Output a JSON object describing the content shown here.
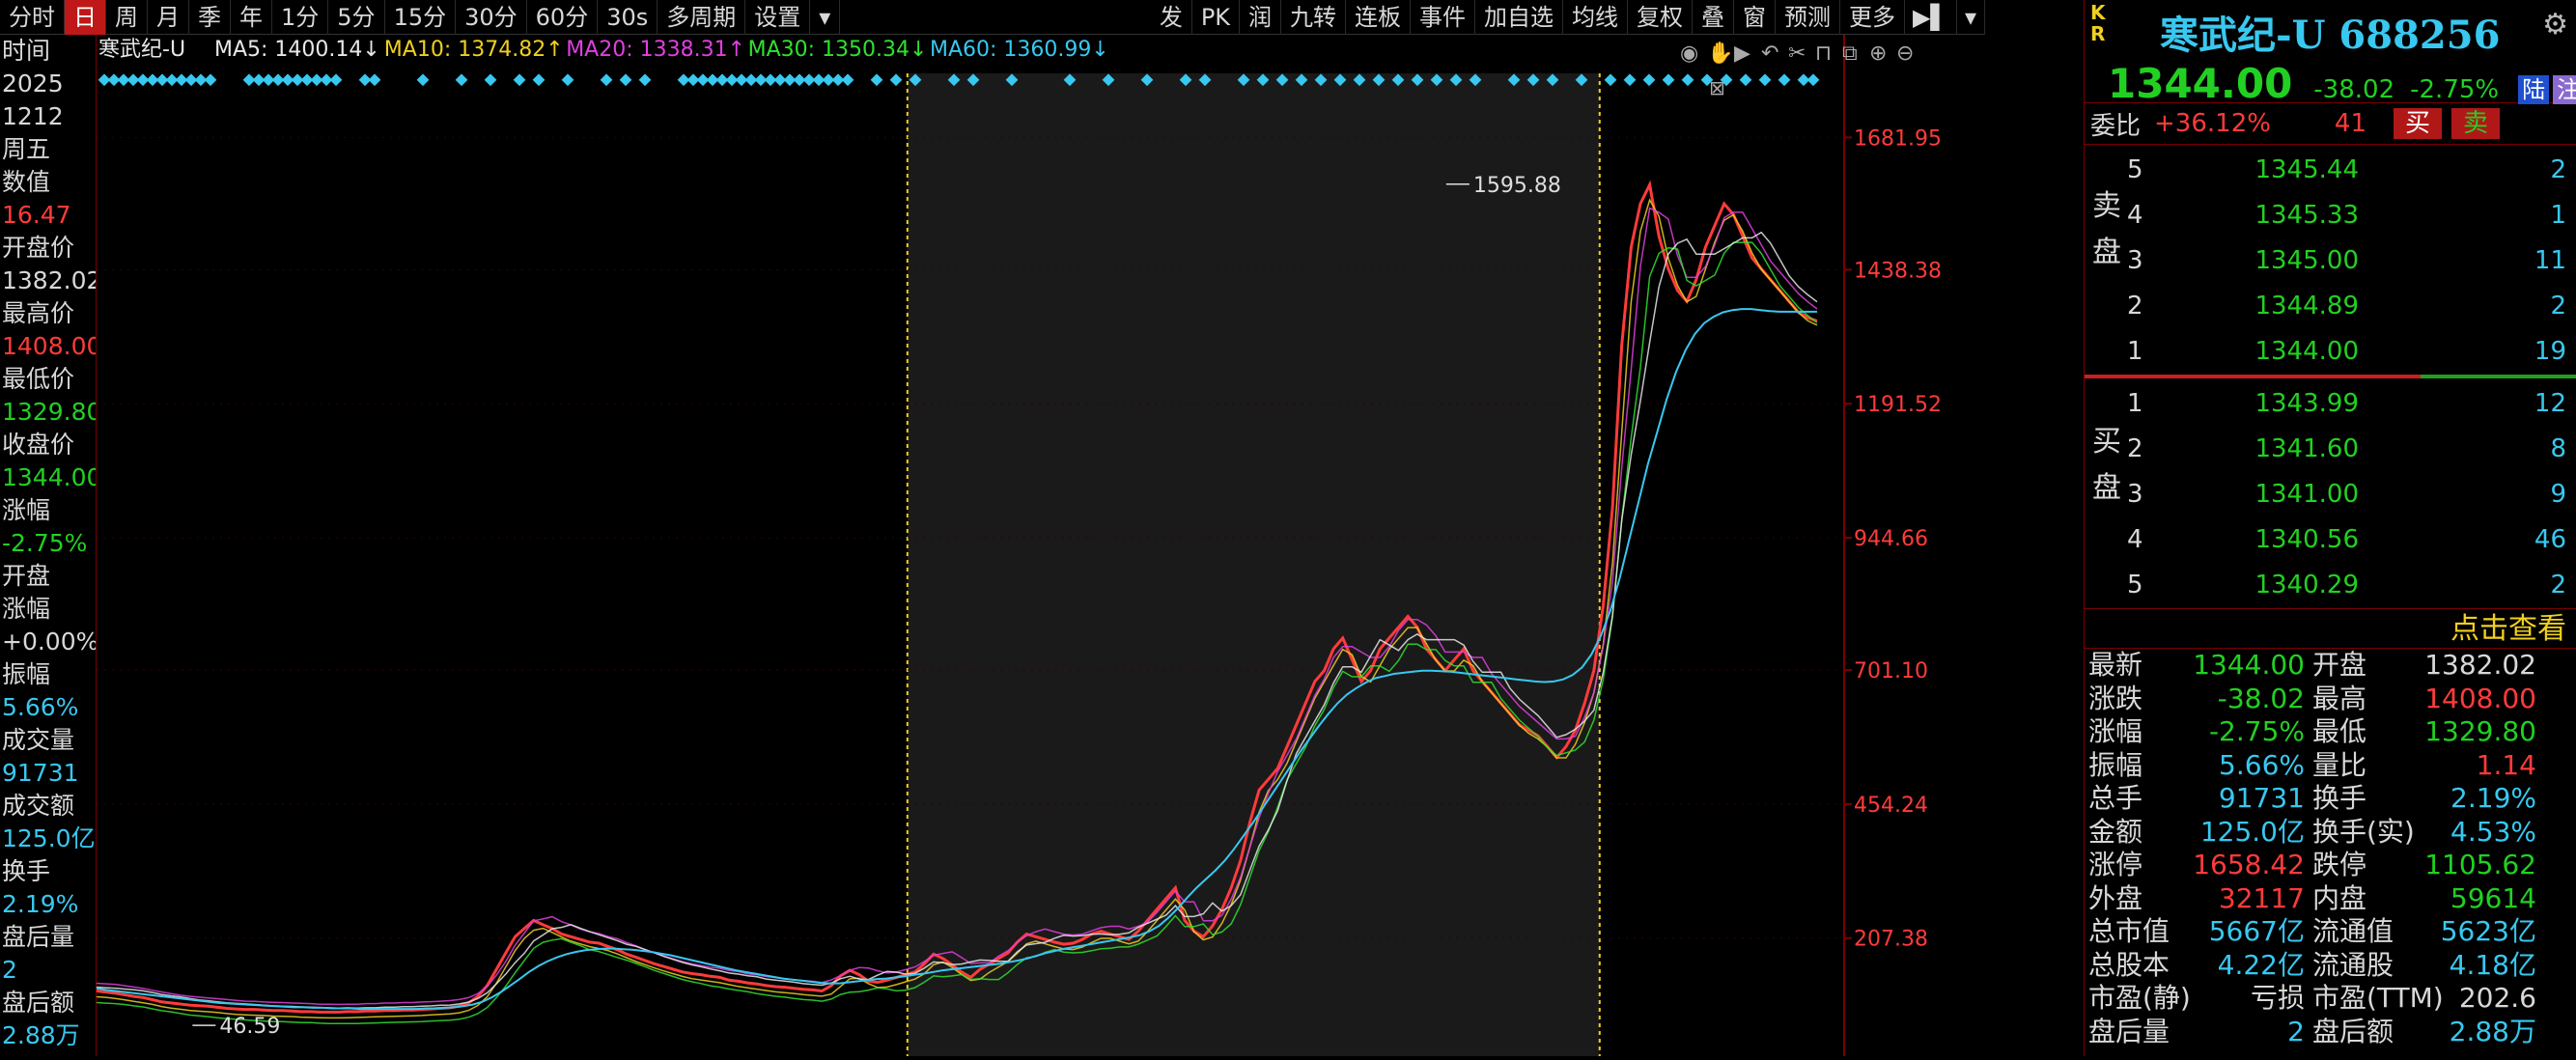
{
  "toolbar": {
    "left_items": [
      "分时",
      "日",
      "周",
      "月",
      "季",
      "年",
      "1分",
      "5分",
      "15分",
      "30分",
      "60分",
      "30s",
      "多周期",
      "设置"
    ],
    "active_item": "日",
    "dropdown_item": "30s",
    "right_items": [
      "发",
      "PK",
      "润",
      "九转",
      "连板",
      "事件",
      "加自选",
      "均线",
      "复权",
      "叠",
      "窗",
      "预测",
      "更多"
    ]
  },
  "left_panel": {
    "rows": [
      {
        "text": "时间",
        "color": "w"
      },
      {
        "text": "2025",
        "color": "w"
      },
      {
        "text": "1212",
        "color": "w"
      },
      {
        "text": "周五",
        "color": "w"
      },
      {
        "text": "数值",
        "color": "w"
      },
      {
        "text": "16.47",
        "color": "r"
      },
      {
        "text": "开盘价",
        "color": "w"
      },
      {
        "text": "1382.02",
        "color": "w"
      },
      {
        "text": "最高价",
        "color": "w"
      },
      {
        "text": "1408.00",
        "color": "r"
      },
      {
        "text": "最低价",
        "color": "w"
      },
      {
        "text": "1329.80",
        "color": "g"
      },
      {
        "text": "收盘价",
        "color": "w"
      },
      {
        "text": "1344.00",
        "color": "g"
      },
      {
        "text": "涨幅",
        "color": "w"
      },
      {
        "text": "-2.75%",
        "color": "g"
      },
      {
        "text": "开盘",
        "color": "w"
      },
      {
        "text": "涨幅",
        "color": "w"
      },
      {
        "text": "+0.00%",
        "color": "w"
      },
      {
        "text": "振幅",
        "color": "w"
      },
      {
        "text": "5.66%",
        "color": "c"
      },
      {
        "text": "成交量",
        "color": "w"
      },
      {
        "text": "91731",
        "color": "c"
      },
      {
        "text": "成交额",
        "color": "w"
      },
      {
        "text": "125.0亿",
        "color": "c"
      },
      {
        "text": "换手",
        "color": "w"
      },
      {
        "text": "2.19%",
        "color": "c"
      },
      {
        "text": "盘后量",
        "color": "w"
      },
      {
        "text": "2",
        "color": "c"
      },
      {
        "text": "盘后额",
        "color": "w"
      },
      {
        "text": "2.88万",
        "color": "c"
      }
    ]
  },
  "chart_header": {
    "stock": "寒武纪-U",
    "ma": [
      {
        "label": "MA5: 1400.14↓",
        "color": "#e8e8e8"
      },
      {
        "label": "MA10: 1374.82↑",
        "color": "#f0d020"
      },
      {
        "label": "MA20: 1338.31↑",
        "color": "#e040e0"
      },
      {
        "label": "MA30: 1350.34↓",
        "color": "#30e030"
      },
      {
        "label": "MA60: 1360.99↓",
        "color": "#38c8f0"
      }
    ]
  },
  "chart_data": {
    "type": "line",
    "y_ticks": [
      1681.95,
      1438.38,
      1191.52,
      944.66,
      701.1,
      454.24,
      207.38
    ],
    "ylim": [
      -10,
      1800
    ],
    "annotations": [
      {
        "label": "1595.88",
        "x": 0.774,
        "value": 1595.88
      },
      {
        "label": "46.59",
        "x": 0.055,
        "value": 46.59
      }
    ],
    "highlight_range": [
      0.465,
      0.862
    ],
    "series": [
      {
        "name": "K",
        "color": "#ff3b3b",
        "values": [
          110,
          108,
          106,
          103,
          100,
          98,
          94,
          90,
          88,
          86,
          84,
          83,
          82,
          80,
          78,
          77,
          76,
          76,
          75,
          74,
          74,
          73,
          72,
          72,
          71,
          71,
          71,
          72,
          72,
          73,
          73,
          74,
          74,
          75,
          75,
          76,
          77,
          78,
          79,
          82,
          88,
          100,
          120,
          150,
          180,
          210,
          225,
          240,
          232,
          225,
          215,
          210,
          205,
          200,
          198,
          192,
          186,
          178,
          172,
          166,
          160,
          155,
          150,
          145,
          142,
          140,
          137,
          135,
          130,
          128,
          125,
          123,
          120,
          118,
          117,
          115,
          113,
          112,
          110,
          120,
          138,
          148,
          140,
          128,
          126,
          130,
          135,
          140,
          145,
          160,
          178,
          170,
          158,
          145,
          135,
          150,
          160,
          170,
          180,
          200,
          215,
          210,
          205,
          200,
          196,
          198,
          205,
          215,
          220,
          215,
          210,
          205,
          220,
          240,
          260,
          280,
          300,
          240,
          220,
          210,
          230,
          260,
          300,
          350,
          420,
          480,
          500,
          520,
          560,
          600,
          640,
          680,
          700,
          740,
          760,
          720,
          680,
          700,
          740,
          760,
          780,
          800,
          780,
          740,
          720,
          700,
          720,
          740,
          700,
          680,
          660,
          640,
          620,
          600,
          590,
          580,
          560,
          540,
          560,
          590,
          640,
          700,
          820,
          1000,
          1300,
          1480,
          1560,
          1595,
          1500,
          1440,
          1400,
          1380,
          1420,
          1480,
          1520,
          1560,
          1540,
          1500,
          1460,
          1440,
          1420,
          1400,
          1380,
          1360,
          1350,
          1344
        ]
      },
      {
        "name": "MA60",
        "color": "#38c8f0",
        "values": [
          115,
          112,
          110,
          108,
          106,
          104,
          102,
          100,
          98,
          96,
          94,
          92,
          90,
          88,
          87,
          86,
          85,
          84,
          83,
          82,
          81,
          80,
          80,
          79,
          79,
          78,
          78,
          78,
          77,
          77,
          77,
          77,
          77,
          77,
          77,
          78,
          78,
          79,
          80,
          82,
          85,
          90,
          98,
          108,
          120,
          132,
          145,
          156,
          165,
          172,
          178,
          182,
          185,
          187,
          188,
          188,
          187,
          186,
          184,
          182,
          179,
          176,
          172,
          168,
          164,
          160,
          156,
          152,
          148,
          145,
          142,
          139,
          136,
          133,
          131,
          129,
          127,
          125,
          124,
          124,
          126,
          128,
          130,
          132,
          133,
          135,
          137,
          140,
          142,
          145,
          148,
          150,
          152,
          154,
          156,
          158,
          160,
          163,
          166,
          170,
          175,
          180,
          184,
          188,
          191,
          194,
          197,
          200,
          203,
          206,
          209,
          213,
          220,
          230,
          245,
          262,
          282,
          300,
          316,
          332,
          350,
          372,
          396,
          420,
          446,
          472,
          498,
          524,
          550,
          574,
          598,
          620,
          640,
          656,
          668,
          678,
          686,
          690,
          694,
          696,
          698,
          700,
          700,
          699,
          698,
          696,
          694,
          692,
          690,
          688,
          686,
          684,
          682,
          680,
          679,
          680,
          684,
          692,
          706,
          730,
          764,
          810,
          870,
          940,
          1010,
          1080,
          1140,
          1200,
          1250,
          1290,
          1320,
          1340,
          1352,
          1360,
          1364,
          1366,
          1366,
          1364,
          1362,
          1361,
          1361,
          1361,
          1361,
          1361
        ]
      }
    ]
  },
  "quote": {
    "name": "寒武纪-U 688256",
    "price": "1344.00",
    "change": "-38.02",
    "change_pct": "-2.75%",
    "tag1": "陆",
    "tag2": "注",
    "webi_label": "委比",
    "webi_value": "+36.12%",
    "webi_count": "41",
    "buy_btn": "买",
    "sell_btn": "卖",
    "sell_side_label": "卖\n盘",
    "buy_side_label": "买\n盘",
    "asks": [
      {
        "lvl": "5",
        "px": "1345.44",
        "vol": "2"
      },
      {
        "lvl": "4",
        "px": "1345.33",
        "vol": "1"
      },
      {
        "lvl": "3",
        "px": "1345.00",
        "vol": "11"
      },
      {
        "lvl": "2",
        "px": "1344.89",
        "vol": "2"
      },
      {
        "lvl": "1",
        "px": "1344.00",
        "vol": "19"
      }
    ],
    "bids": [
      {
        "lvl": "1",
        "px": "1343.99",
        "vol": "12"
      },
      {
        "lvl": "2",
        "px": "1341.60",
        "vol": "8"
      },
      {
        "lvl": "3",
        "px": "1341.00",
        "vol": "9"
      },
      {
        "lvl": "4",
        "px": "1340.56",
        "vol": "46"
      },
      {
        "lvl": "5",
        "px": "1340.29",
        "vol": "2"
      }
    ],
    "click_more": "点击查看",
    "stats": [
      {
        "k": "最新",
        "v": "1344.00",
        "c": "g",
        "k2": "开盘",
        "v2": "1382.02",
        "c2": "w"
      },
      {
        "k": "涨跌",
        "v": "-38.02",
        "c": "g",
        "k2": "最高",
        "v2": "1408.00",
        "c2": "r"
      },
      {
        "k": "涨幅",
        "v": "-2.75%",
        "c": "g",
        "k2": "最低",
        "v2": "1329.80",
        "c2": "g"
      },
      {
        "k": "振幅",
        "v": "5.66%",
        "c": "c",
        "k2": "量比",
        "v2": "1.14",
        "c2": "r"
      },
      {
        "k": "总手",
        "v": "91731",
        "c": "c",
        "k2": "换手",
        "v2": "2.19%",
        "c2": "c"
      },
      {
        "k": "金额",
        "v": "125.0亿",
        "c": "c",
        "k2": "换手(实)",
        "v2": "4.53%",
        "c2": "c"
      },
      {
        "k": "涨停",
        "v": "1658.42",
        "c": "r",
        "k2": "跌停",
        "v2": "1105.62",
        "c2": "g"
      },
      {
        "k": "外盘",
        "v": "32117",
        "c": "r",
        "k2": "内盘",
        "v2": "59614",
        "c2": "g"
      },
      {
        "k": "总市值",
        "v": "5667亿",
        "c": "c",
        "k2": "流通值",
        "v2": "5623亿",
        "c2": "c"
      },
      {
        "k": "总股本",
        "v": "4.22亿",
        "c": "c",
        "k2": "流通股",
        "v2": "4.18亿",
        "c2": "c"
      },
      {
        "k": "市盈(静)",
        "v": "亏损",
        "c": "w",
        "k2": "市盈(TTM)",
        "v2": "202.6",
        "c2": "w"
      },
      {
        "k": "盘后量",
        "v": "2",
        "c": "c",
        "k2": "盘后额",
        "v2": "2.88万",
        "c2": "c"
      }
    ]
  },
  "colors": {
    "up": "#ff3b3b",
    "down": "#22d022",
    "cyan": "#38c8f0",
    "yellow": "#f0d020",
    "frame": "#7a0000"
  }
}
